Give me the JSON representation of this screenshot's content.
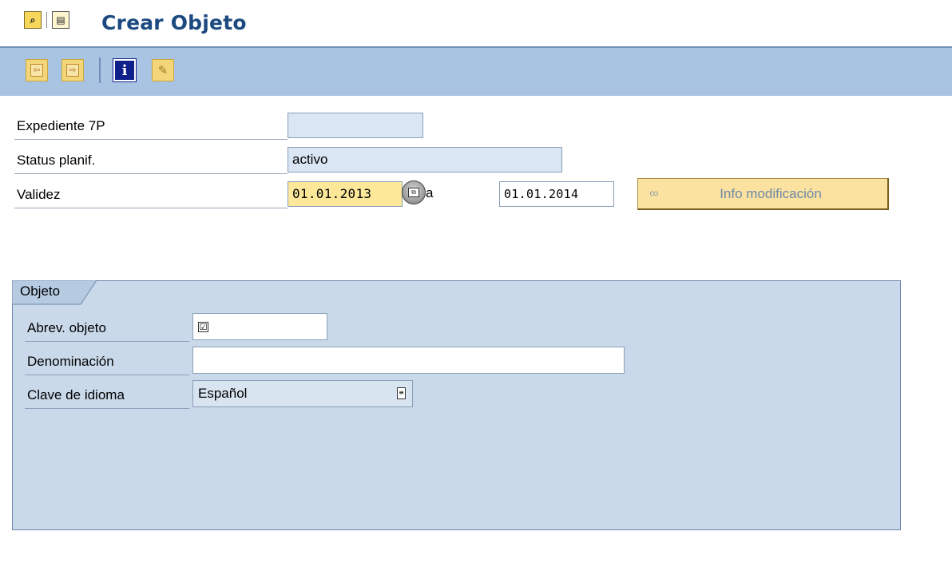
{
  "window": {
    "title": "Crear Objeto"
  },
  "toolbar": {
    "buttons": [
      {
        "icon": "previous-object-icon",
        "glyph": "⇦"
      },
      {
        "icon": "next-object-icon",
        "glyph": "⇨"
      },
      {
        "icon": "info-icon",
        "glyph": "i"
      },
      {
        "icon": "edit-icon",
        "glyph": "✎"
      }
    ]
  },
  "form": {
    "expediente": {
      "label": "Expediente 7P",
      "value": ""
    },
    "status": {
      "label": "Status planif.",
      "value": "activo"
    },
    "validez": {
      "label": "Validez",
      "from": "01.01.2013",
      "to_label": "a",
      "to": "01.01.2014"
    },
    "info_button": {
      "label": "Info modificación",
      "icon": "glasses-icon"
    }
  },
  "objeto_group": {
    "title": "Objeto",
    "abrev": {
      "label": "Abrev. objeto",
      "value": "",
      "checkbox": "☑"
    },
    "denominacion": {
      "label": "Denominación",
      "value": ""
    },
    "idioma": {
      "label": "Clave de idioma",
      "value": "Español"
    }
  },
  "colors": {
    "title": "#1c4a80",
    "toolbar_bg": "#a9c3e2",
    "required_field": "#fde89a",
    "group_bg": "#c9d9ea"
  }
}
